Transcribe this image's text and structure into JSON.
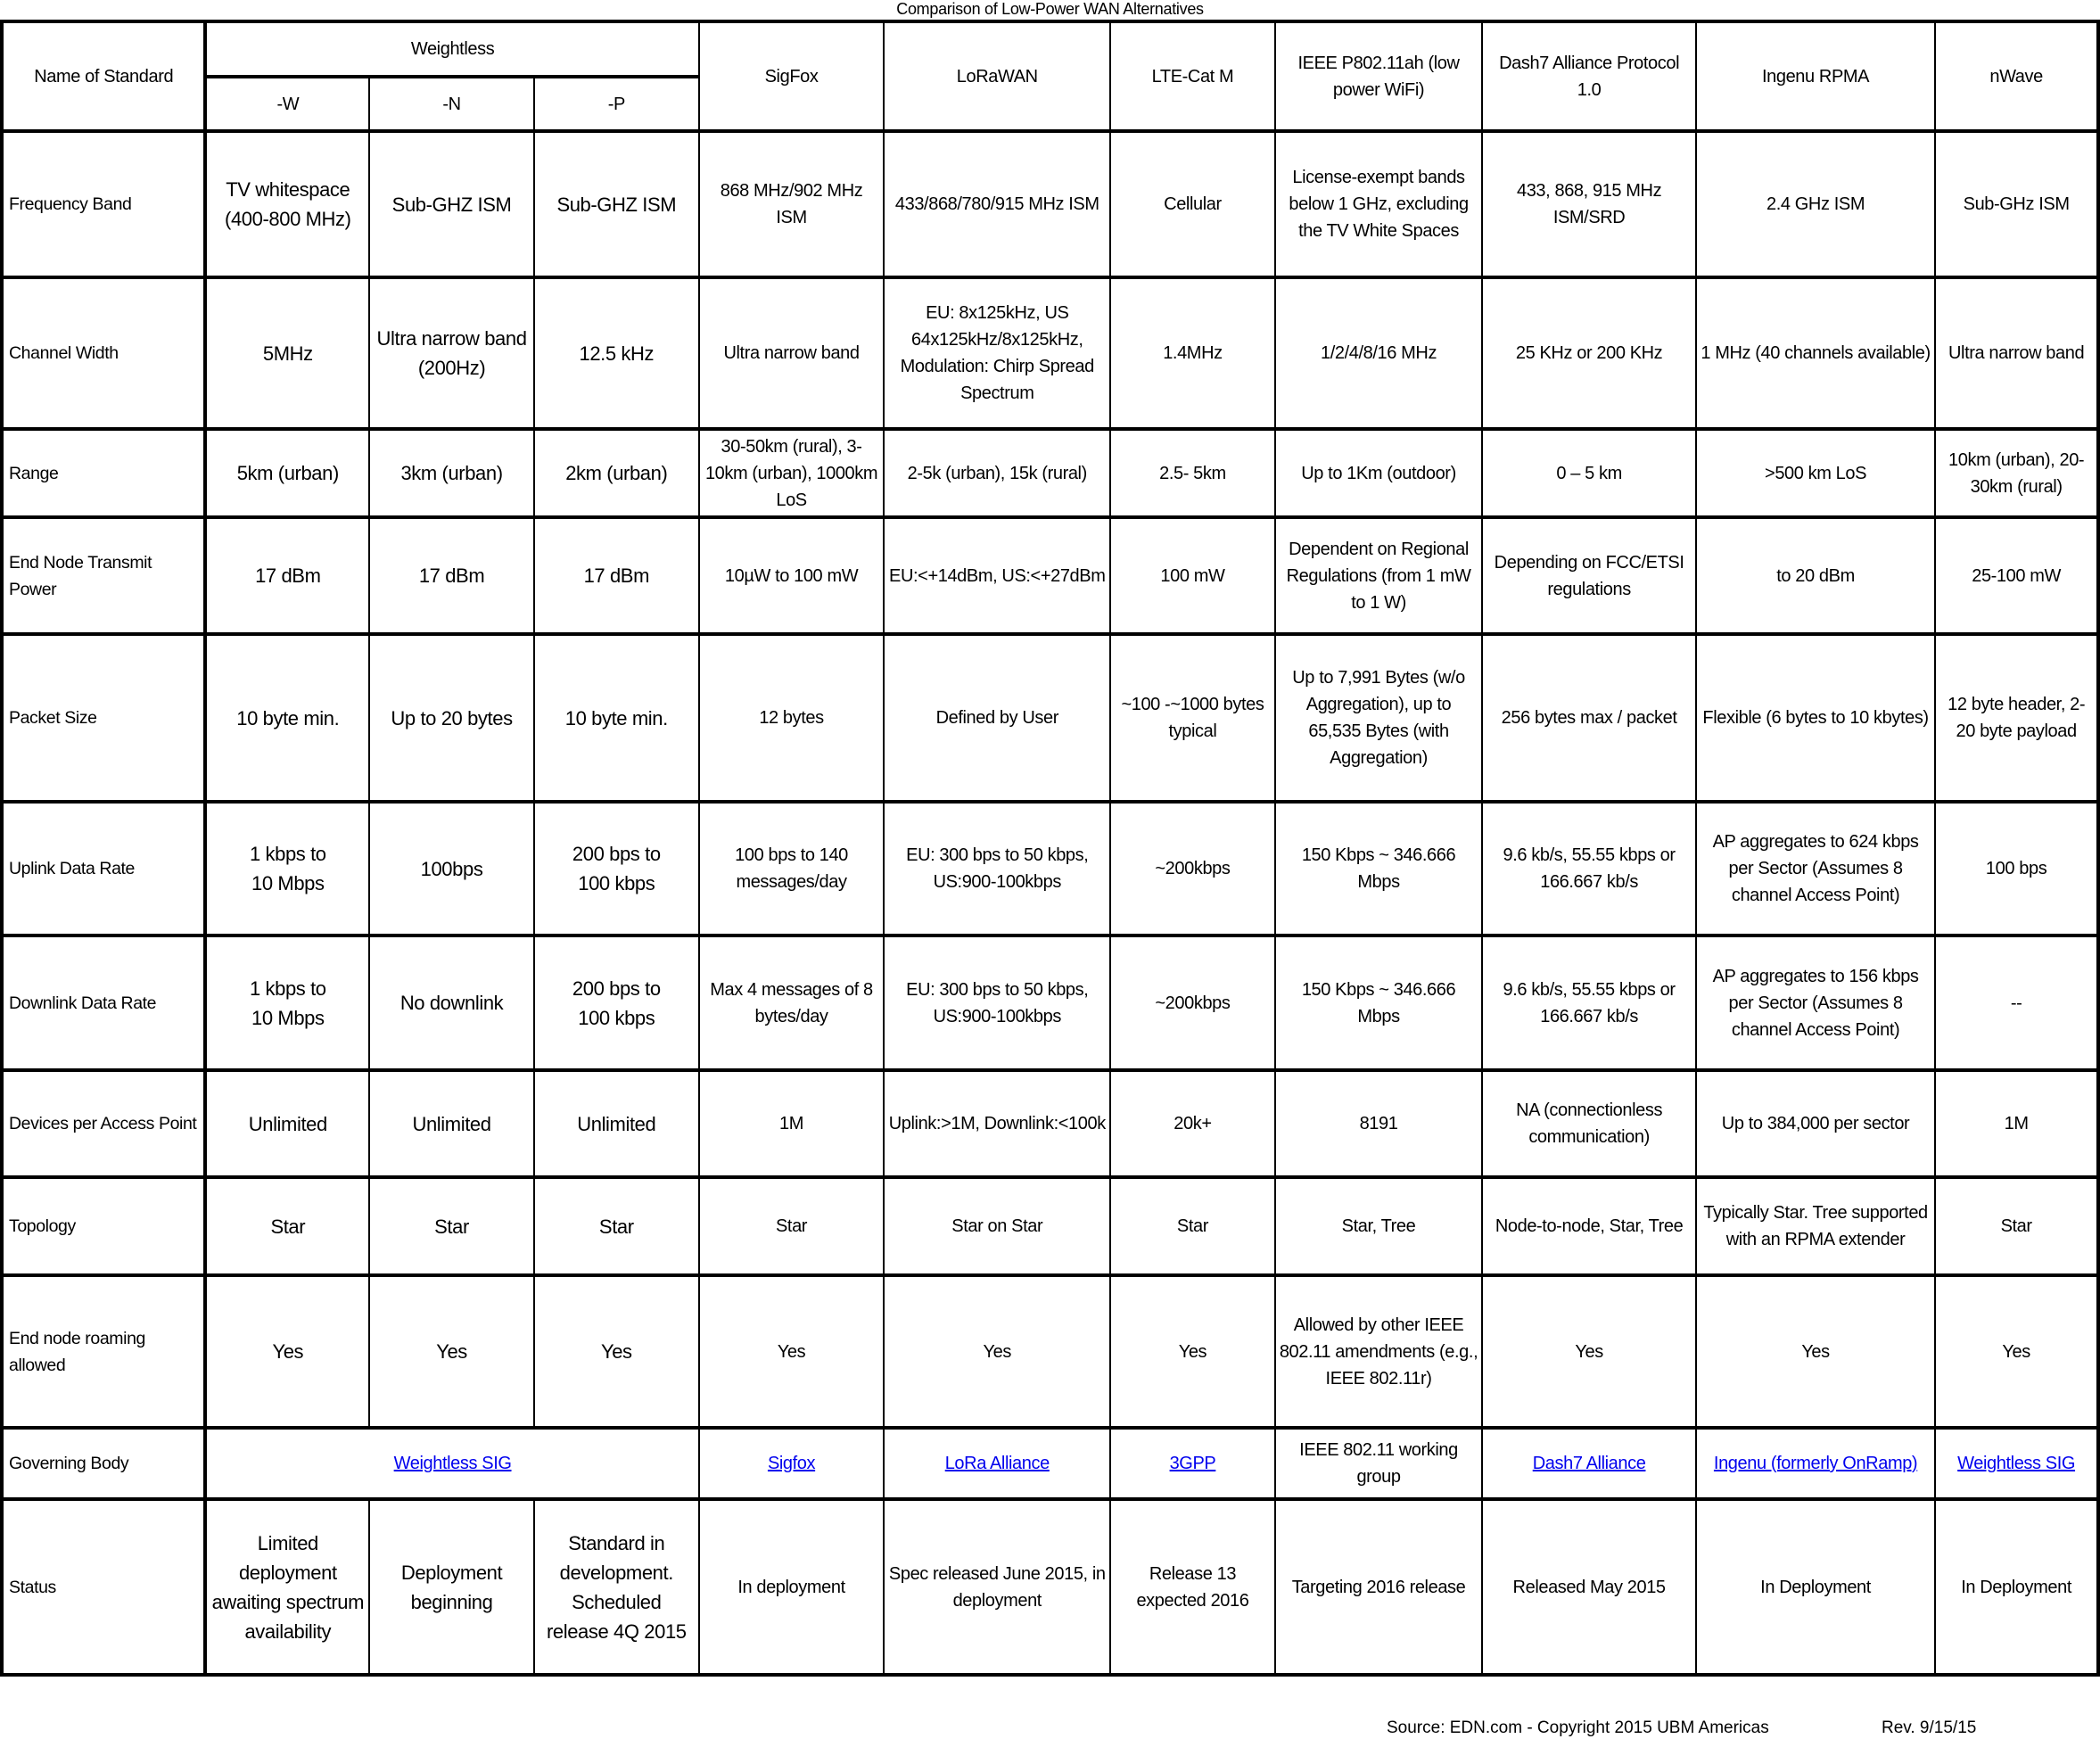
{
  "title": "Comparison of Low-Power WAN Alternatives",
  "header": {
    "name_label": "Name of Standard",
    "group": "Weightless",
    "sub": [
      "-W",
      "-N",
      "-P"
    ],
    "standards": [
      "SigFox",
      "LoRaWAN",
      "LTE-Cat M",
      "IEEE P802.11ah (low power WiFi)",
      "Dash7 Alliance Protocol 1.0",
      "Ingenu RPMA",
      "nWave"
    ]
  },
  "rows": [
    {
      "label": "Frequency Band",
      "cells": [
        "TV whitespace (400-800 MHz)",
        "Sub-GHZ ISM",
        "Sub-GHZ ISM",
        "868 MHz/902 MHz ISM",
        "433/868/780/915 MHz ISM",
        "Cellular",
        "License-exempt bands below 1 GHz, excluding the TV White Spaces",
        "433, 868, 915 MHz ISM/SRD",
        "2.4 GHz ISM",
        "Sub-GHz ISM"
      ]
    },
    {
      "label": "Channel Width",
      "cells": [
        "5MHz",
        "Ultra narrow band (200Hz)",
        "12.5 kHz",
        "Ultra narrow band",
        "EU: 8x125kHz, US 64x125kHz/8x125kHz, Modulation: Chirp Spread Spectrum",
        "1.4MHz",
        "1/2/4/8/16 MHz",
        "25 KHz or 200 KHz",
        "1 MHz (40 channels available)",
        "Ultra narrow band"
      ]
    },
    {
      "label": "Range",
      "cells": [
        "5km (urban)",
        "3km (urban)",
        "2km (urban)",
        "30-50km (rural),   3-10km (urban), 1000km LoS",
        "2-5k (urban), 15k (rural)",
        "2.5- 5km",
        "Up to 1Km (outdoor)",
        "0 – 5 km",
        ">500 km LoS",
        "10km (urban), 20-30km (rural)"
      ]
    },
    {
      "label": "End Node Transmit Power",
      "cells": [
        "17 dBm",
        "17 dBm",
        "17 dBm",
        "10µW to 100 mW",
        "EU:<+14dBm, US:<+27dBm",
        "100 mW",
        "Dependent on Regional Regulations      (from 1 mW to 1 W)",
        "Depending on FCC/ETSI regulations",
        "to 20 dBm",
        "25-100 mW"
      ]
    },
    {
      "label": "Packet Size",
      "cells": [
        "10 byte min.",
        "Up to 20 bytes",
        "10 byte min.",
        "12 bytes",
        "Defined by User",
        "~100 -~1000 bytes typical",
        "Up to 7,991 Bytes (w/o Aggregation),  up to 65,535 Bytes (with Aggregation)",
        "256 bytes max / packet",
        "Flexible (6 bytes to 10 kbytes)",
        "12 byte header, 2-20 byte payload"
      ]
    },
    {
      "label": "Uplink Data Rate",
      "cells": [
        "1 kbps to\n10 Mbps",
        "100bps",
        "200 bps to\n100 kbps",
        "100 bps to 140 messages/day",
        "EU: 300 bps to 50 kbps, US:900-100kbps",
        "~200kbps",
        "150 Kbps ~ 346.666 Mbps",
        "9.6 kb/s, 55.55 kbps or 166.667 kb/s",
        "AP aggregates to 624 kbps per Sector (Assumes 8 channel Access Point)",
        "100 bps"
      ]
    },
    {
      "label": "Downlink Data Rate",
      "cells": [
        "1 kbps to\n10 Mbps",
        "No downlink",
        "200 bps to\n100 kbps",
        "Max 4 messages of 8 bytes/day",
        "EU: 300 bps to 50 kbps, US:900-100kbps",
        "~200kbps",
        "150 Kbps ~ 346.666 Mbps",
        "9.6 kb/s, 55.55 kbps or 166.667 kb/s",
        "AP aggregates to 156 kbps per Sector   (Assumes 8 channel Access Point)",
        "--"
      ]
    },
    {
      "label": "Devices per Access Point",
      "cells": [
        "Unlimited",
        "Unlimited",
        "Unlimited",
        "1M",
        "Uplink:>1M, Downlink:<100k",
        "20k+",
        "8191",
        "NA (connectionless communication)",
        "Up to 384,000 per sector",
        "1M"
      ]
    },
    {
      "label": "Topology",
      "cells": [
        "Star",
        "Star",
        "Star",
        "Star",
        "Star on Star",
        "Star",
        "Star, Tree",
        "Node-to-node, Star, Tree",
        "Typically Star. Tree supported with an RPMA extender",
        "Star"
      ]
    },
    {
      "label": "End node roaming allowed",
      "cells": [
        "Yes",
        "Yes",
        "Yes",
        "Yes",
        "Yes",
        "Yes",
        "Allowed by other IEEE 802.11 amendments (e.g., IEEE 802.11r)",
        "Yes",
        "Yes",
        "Yes"
      ]
    }
  ],
  "governing": {
    "label": "Governing Body",
    "weightless": "Weightless SIG",
    "cells": [
      "Sigfox",
      "LoRa Alliance",
      "3GPP",
      "IEEE 802.11 working group",
      "Dash7 Alliance",
      "Ingenu (formerly OnRamp)",
      "Weightless SIG"
    ]
  },
  "status": {
    "label": "Status",
    "cells": [
      "Limited deployment awaiting spectrum availability",
      "Deployment beginning",
      "Standard in development. Scheduled release 4Q 2015",
      "In deployment",
      "Spec released June 2015, in deployment",
      "Release 13 expected 2016",
      "Targeting 2016 release",
      "Released May 2015",
      "In Deployment",
      "In Deployment"
    ]
  },
  "footer": {
    "source": "Source: EDN.com - Copyright 2015 UBM Americas",
    "revision": "Rev. 9/15/15"
  },
  "colors": {
    "link": "#0000ee",
    "border": "#000000"
  }
}
